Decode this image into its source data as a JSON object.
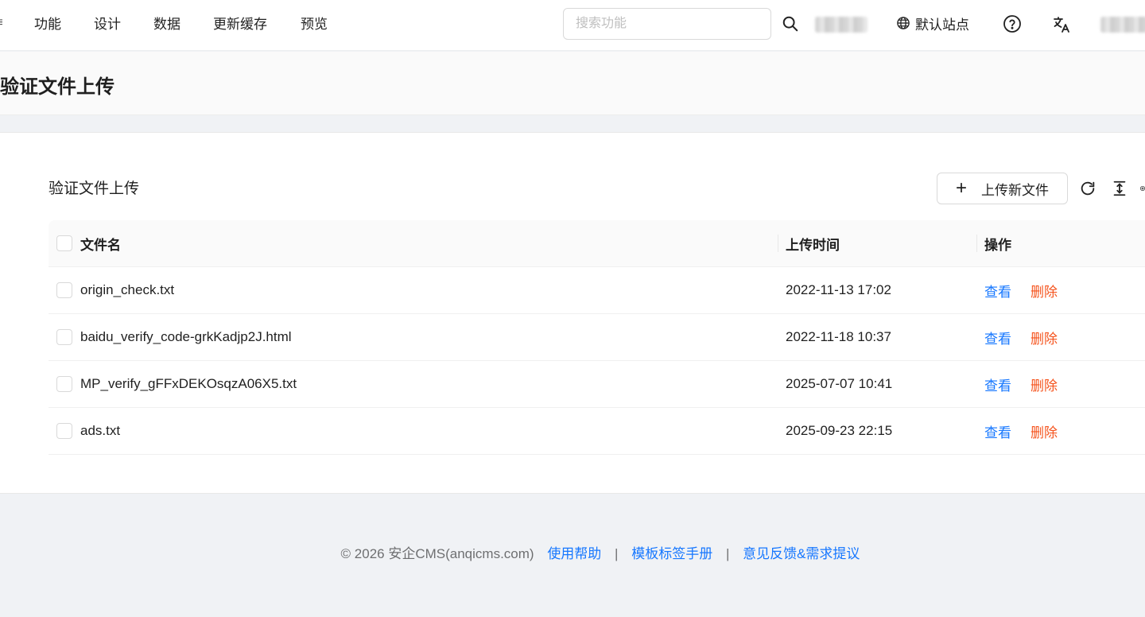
{
  "nav": {
    "edge_glyph": "≡",
    "items": [
      {
        "label": "功能"
      },
      {
        "label": "设计"
      },
      {
        "label": "数据"
      },
      {
        "label": "更新缓存"
      },
      {
        "label": "预览"
      }
    ],
    "search_placeholder": "搜索功能",
    "site_label": "默认站点"
  },
  "page": {
    "title": "验证文件上传"
  },
  "card": {
    "title": "验证文件上传",
    "upload_label": "上传新文件",
    "upload_plus": "+"
  },
  "table": {
    "headers": {
      "name": "文件名",
      "time": "上传时间",
      "ops": "操作"
    },
    "rows": [
      {
        "name": "origin_check.txt",
        "time": "2022-11-13 17:02",
        "view": "查看",
        "delete": "删除"
      },
      {
        "name": "baidu_verify_code-grkKadjp2J.html",
        "time": "2022-11-18 10:37",
        "view": "查看",
        "delete": "删除"
      },
      {
        "name": "MP_verify_gFFxDEKOsqzA06X5.txt",
        "time": "2025-07-07 10:41",
        "view": "查看",
        "delete": "删除"
      },
      {
        "name": "ads.txt",
        "time": "2025-09-23 22:15",
        "view": "查看",
        "delete": "删除"
      }
    ]
  },
  "footer": {
    "copyright": "© 2026 安企CMS(anqicms.com)",
    "link_help": "使用帮助",
    "link_tags": "模板标签手册",
    "link_feedback": "意见反馈&需求提议",
    "separator": "|"
  },
  "colors": {
    "link": "#1677ff",
    "danger": "#f5541e",
    "background": "#f0f2f5"
  }
}
